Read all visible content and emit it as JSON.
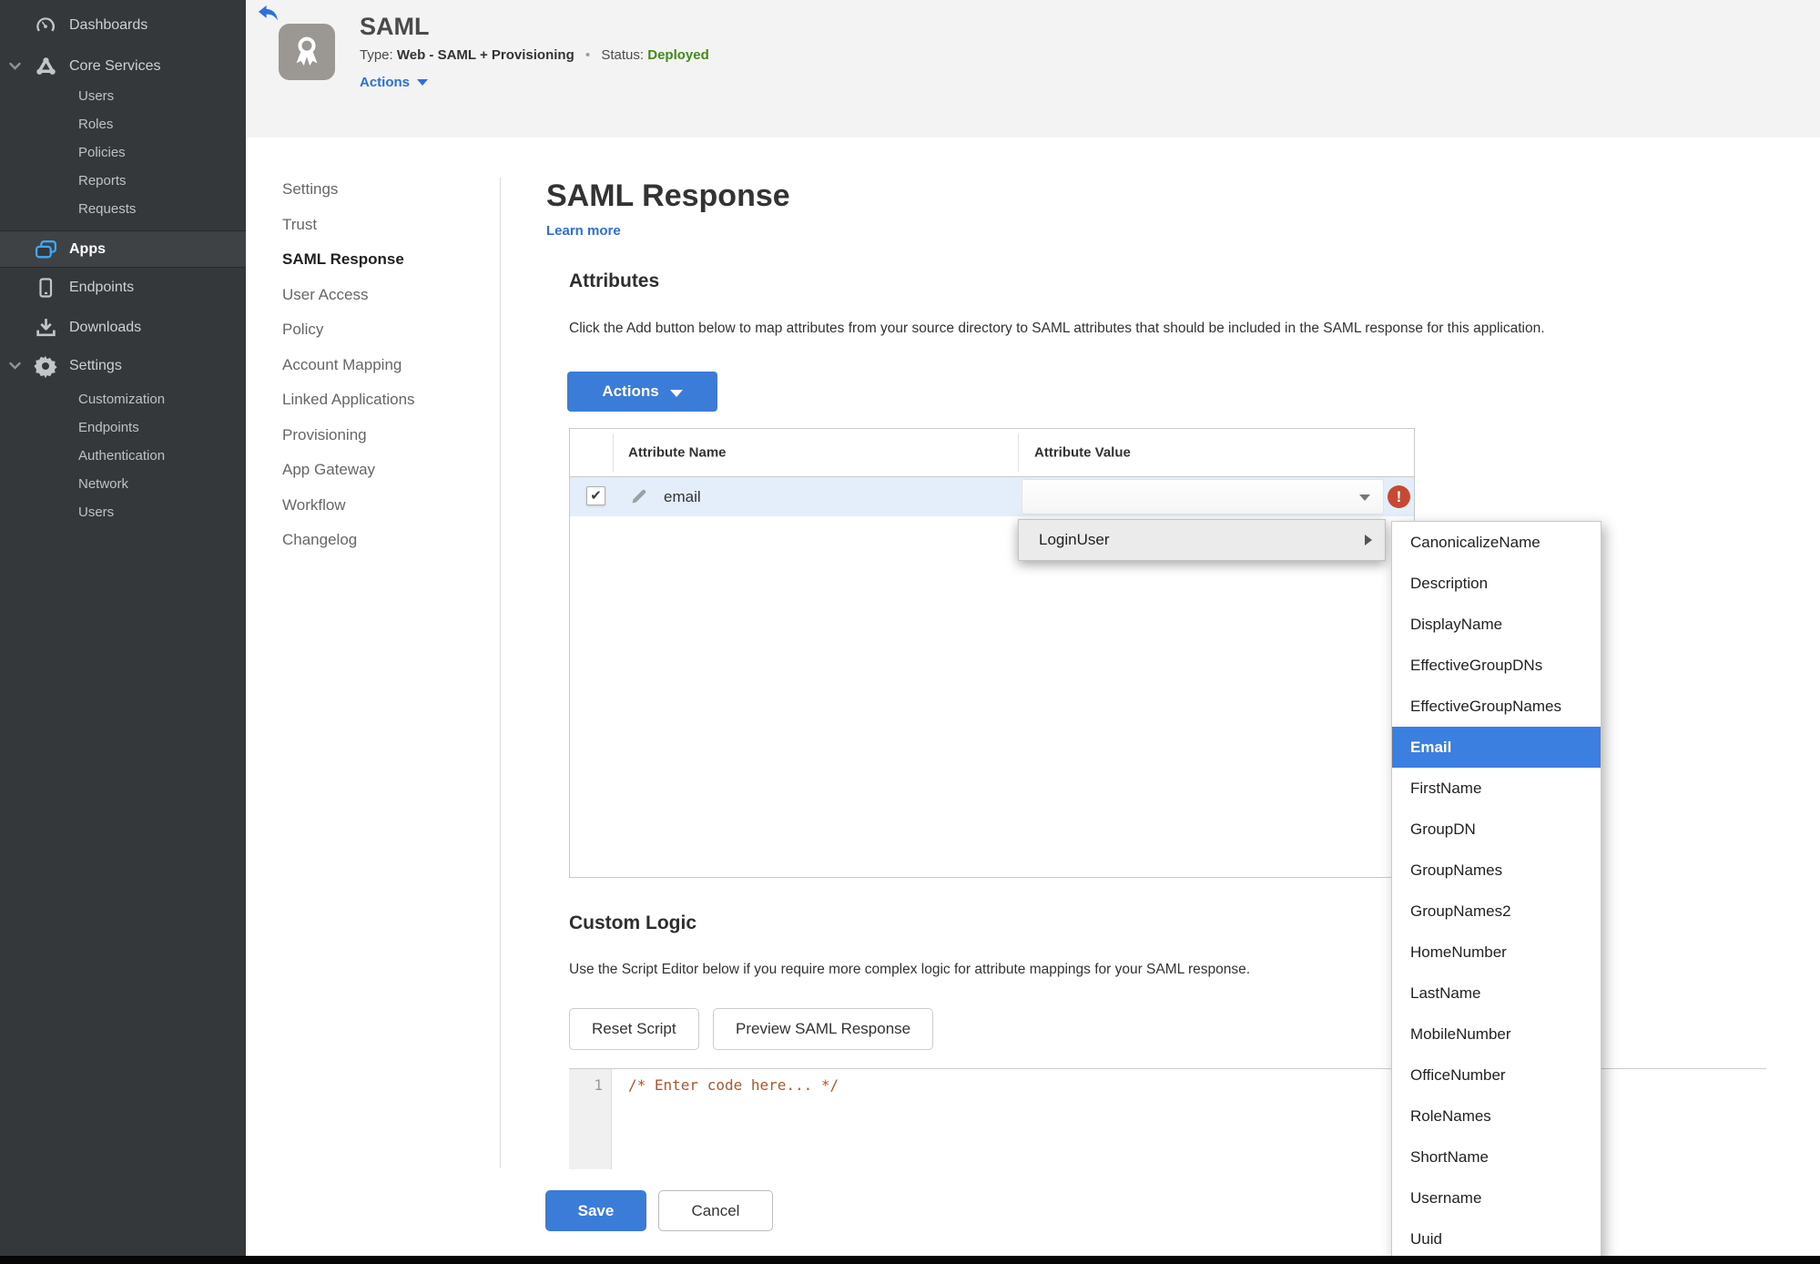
{
  "colors": {
    "accent_blue": "#3b7cd9",
    "link_blue": "#2b6fdb",
    "status_green": "#44891d",
    "error_red": "#c64a33",
    "selected_blue": "#3b7fe0",
    "apps_icon_blue": "#3fa9f5",
    "row_highlight": "#e4edfa",
    "sidebar_bg": "#35383a",
    "header_bg": "#f3f3f4",
    "code_orange": "#b0552d"
  },
  "sidebar": {
    "dashboards": "Dashboards",
    "core_services": "Core Services",
    "core_services_children": [
      "Users",
      "Roles",
      "Policies",
      "Reports",
      "Requests"
    ],
    "apps": "Apps",
    "endpoints": "Endpoints",
    "downloads": "Downloads",
    "settings": "Settings",
    "settings_children": [
      "Customization",
      "Endpoints",
      "Authentication",
      "Network",
      "Users"
    ]
  },
  "header": {
    "title": "SAML",
    "type_label": "Type:",
    "type_value": "Web - SAML + Provisioning",
    "dot": "•",
    "status_label": "Status:",
    "status_value": "Deployed",
    "actions_label": "Actions"
  },
  "subnav": {
    "items": [
      {
        "label": "Settings"
      },
      {
        "label": "Trust"
      },
      {
        "label": "SAML Response",
        "active": true
      },
      {
        "label": "User Access"
      },
      {
        "label": "Policy"
      },
      {
        "label": "Account Mapping"
      },
      {
        "label": "Linked Applications"
      },
      {
        "label": "Provisioning"
      },
      {
        "label": "App Gateway"
      },
      {
        "label": "Workflow"
      },
      {
        "label": "Changelog"
      }
    ]
  },
  "main": {
    "title": "SAML Response",
    "learn_more": "Learn more",
    "attributes": {
      "heading": "Attributes",
      "description": "Click the Add button below to map attributes from your source directory to SAML attributes that should be included in the SAML response for this application.",
      "actions_button": "Actions",
      "table": {
        "col_name": "Attribute Name",
        "col_value": "Attribute Value",
        "row": {
          "name": "email",
          "checked": true,
          "value": ""
        }
      }
    },
    "context_menu": {
      "root": "LoginUser",
      "options": [
        {
          "label": "CanonicalizeName"
        },
        {
          "label": "Description"
        },
        {
          "label": "DisplayName"
        },
        {
          "label": "EffectiveGroupDNs"
        },
        {
          "label": "EffectiveGroupNames"
        },
        {
          "label": "Email",
          "selected": true
        },
        {
          "label": "FirstName"
        },
        {
          "label": "GroupDN"
        },
        {
          "label": "GroupNames"
        },
        {
          "label": "GroupNames2"
        },
        {
          "label": "HomeNumber"
        },
        {
          "label": "LastName"
        },
        {
          "label": "MobileNumber"
        },
        {
          "label": "OfficeNumber"
        },
        {
          "label": "RoleNames"
        },
        {
          "label": "ShortName"
        },
        {
          "label": "Username"
        },
        {
          "label": "Uuid"
        }
      ]
    },
    "custom_logic": {
      "heading": "Custom Logic",
      "description": "Use the Script Editor below if you require more complex logic for attribute mappings for your SAML response.",
      "reset_button": "Reset Script",
      "preview_button": "Preview SAML Response",
      "editor": {
        "line_number": "1",
        "code": "/* Enter code here... */"
      }
    },
    "footer": {
      "save": "Save",
      "cancel": "Cancel"
    }
  }
}
